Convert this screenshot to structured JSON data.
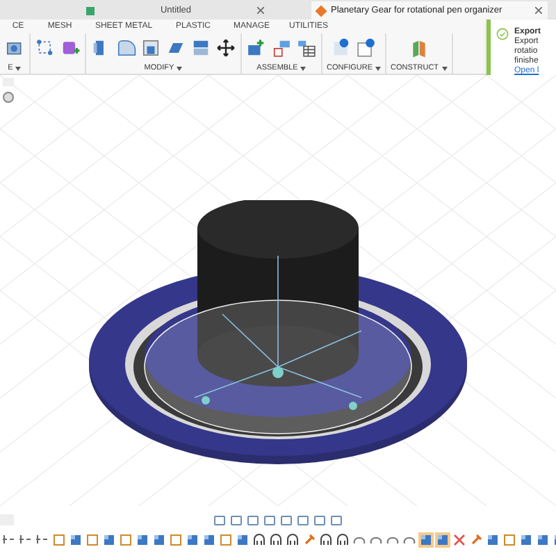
{
  "tabs": [
    {
      "label": "Untitled",
      "selected": false
    },
    {
      "label": "Planetary Gear for rotational pen organizer",
      "selected": true
    }
  ],
  "toolbar_tabs": [
    "CE",
    "MESH",
    "SHEET METAL",
    "PLASTIC",
    "MANAGE",
    "UTILITIES"
  ],
  "tool_groups": [
    {
      "label": "E",
      "tools": [
        {
          "kind": "box"
        }
      ]
    },
    {
      "tools": [
        {
          "kind": "sketch"
        },
        {
          "kind": "form"
        }
      ]
    },
    {
      "label": "MODIFY",
      "tools": [
        {
          "kind": "press"
        },
        {
          "kind": "fillet"
        },
        {
          "kind": "shell"
        },
        {
          "kind": "combine"
        },
        {
          "kind": "replace"
        },
        {
          "kind": "move"
        }
      ]
    },
    {
      "label": "ASSEMBLE",
      "tools": [
        {
          "kind": "joint"
        },
        {
          "kind": "asbuilt"
        },
        {
          "kind": "table"
        }
      ]
    },
    {
      "label": "CONFIGURE",
      "tools": [
        {
          "kind": "config"
        },
        {
          "kind": "configtable"
        }
      ]
    },
    {
      "label": "CONSTRUCT",
      "tools": [
        {
          "kind": "plane"
        }
      ]
    }
  ],
  "notification": {
    "title": "Export",
    "lines": [
      "Export",
      "rotatio",
      "finishe"
    ],
    "link": "Open l"
  },
  "timeline": [
    {
      "kind": "op",
      "selected": false
    },
    {
      "kind": "op",
      "selected": false
    },
    {
      "kind": "op",
      "selected": false
    },
    {
      "kind": "sketch",
      "selected": false
    },
    {
      "kind": "body",
      "selected": false
    },
    {
      "kind": "sketch",
      "selected": false
    },
    {
      "kind": "body",
      "selected": false
    },
    {
      "kind": "sketch",
      "selected": false
    },
    {
      "kind": "body",
      "selected": false
    },
    {
      "kind": "body",
      "selected": false
    },
    {
      "kind": "sketch",
      "selected": false
    },
    {
      "kind": "body",
      "selected": false
    },
    {
      "kind": "body",
      "selected": false
    },
    {
      "kind": "sketch",
      "selected": false
    },
    {
      "kind": "body",
      "selected": false
    },
    {
      "kind": "joint",
      "selected": false
    },
    {
      "kind": "joint",
      "selected": false
    },
    {
      "kind": "joint",
      "selected": false
    },
    {
      "kind": "pin",
      "selected": false
    },
    {
      "kind": "joint",
      "selected": false
    },
    {
      "kind": "joint",
      "selected": false
    },
    {
      "kind": "link",
      "selected": false
    },
    {
      "kind": "link",
      "selected": false
    },
    {
      "kind": "link",
      "selected": false
    },
    {
      "kind": "link",
      "selected": false
    },
    {
      "kind": "body",
      "selected": true
    },
    {
      "kind": "body",
      "selected": true
    },
    {
      "kind": "cross",
      "selected": false
    },
    {
      "kind": "pin",
      "selected": false
    },
    {
      "kind": "body",
      "selected": false
    },
    {
      "kind": "sketch",
      "selected": false
    },
    {
      "kind": "body",
      "selected": false
    },
    {
      "kind": "body",
      "selected": false
    },
    {
      "kind": "body",
      "selected": false
    }
  ]
}
